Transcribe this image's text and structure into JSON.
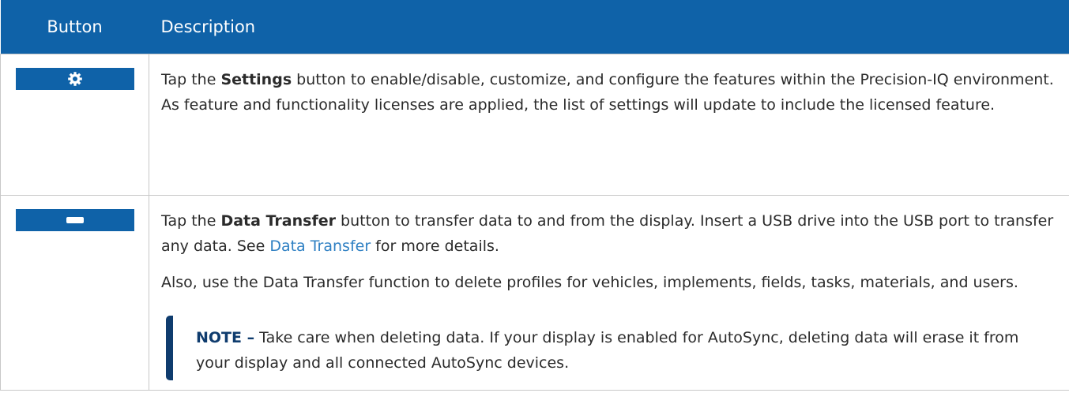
{
  "header": {
    "col_button": "Button",
    "col_description": "Description"
  },
  "rows": [
    {
      "icon": "gear-icon",
      "pre": "Tap the ",
      "bold": "Settings",
      "post": " button to enable/disable, customize, and configure the features within the Precision-IQ environment. As feature and functionality licenses are applied, the list of settings will update to include the licensed feature."
    },
    {
      "icon": "usb-drive-icon",
      "pre": "Tap the ",
      "bold": "Data Transfer",
      "post1": " button to transfer data to and from the display. Insert a USB drive into the USB port to transfer any data. See ",
      "link": "Data Transfer",
      "post2": " for more details.",
      "para2": "Also, use the Data Transfer function to delete profiles for vehicles, implements, fields, tasks, materials, and users.",
      "note_label": "NOTE –",
      "note_text": " Take care when deleting data. If your display is enabled for AutoSync, deleting data will erase it from your display and all connected AutoSync devices."
    }
  ],
  "colors": {
    "header_bg": "#0f62a8",
    "link": "#2f80c3",
    "note_accent": "#0f3c6e"
  }
}
